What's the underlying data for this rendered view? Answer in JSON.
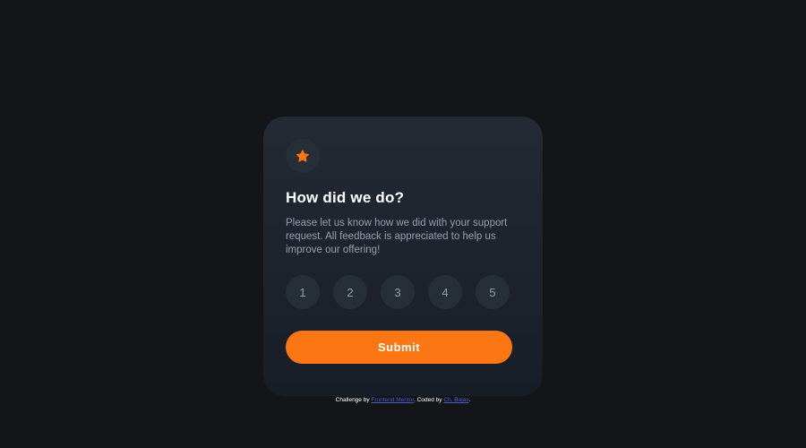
{
  "card": {
    "icon": "star-icon",
    "title": "How did we do?",
    "description": "Please let us know how we did with your support request. All feedback is appreciated to help us improve our offering!",
    "ratings": [
      "1",
      "2",
      "3",
      "4",
      "5"
    ],
    "submit_label": "Submit"
  },
  "attribution": {
    "prefix": "Challenge by ",
    "link1": "Frontend Mentor",
    "middle": ". Coded by ",
    "link2": "Ch. Bajas",
    "suffix": "."
  },
  "colors": {
    "background": "#131518",
    "card": "#232a34",
    "accent": "#fc7614",
    "muted_text": "#969fad",
    "circle": "#262e38",
    "link": "#4a5ecf"
  }
}
